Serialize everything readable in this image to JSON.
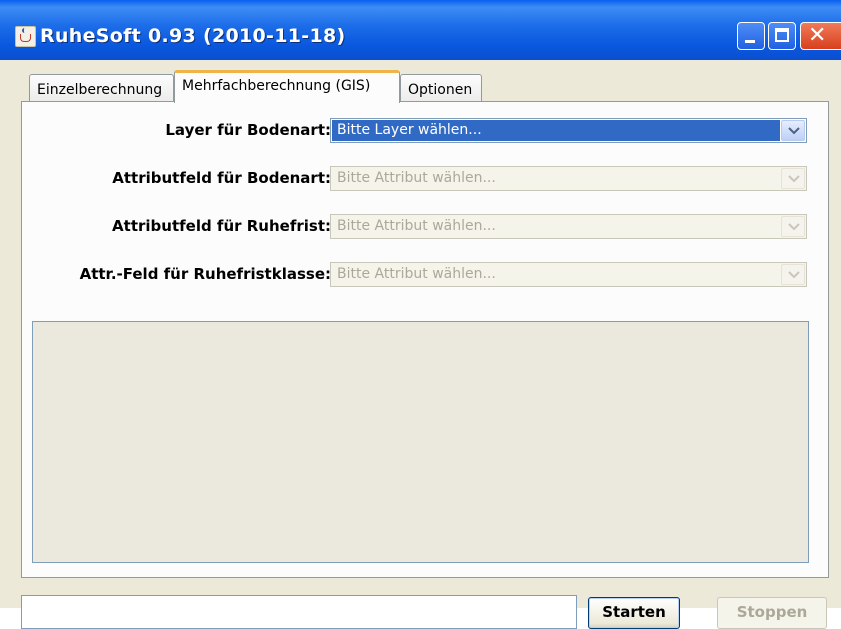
{
  "window": {
    "title": "RuheSoft 0.93 (2010-11-18)",
    "controls": {
      "minimize": "minimize",
      "maximize": "maximize",
      "close": "✕"
    }
  },
  "tabs": [
    {
      "label": "Einzelberechnung",
      "active": false
    },
    {
      "label": "Mehrfachberechnung (GIS)",
      "active": true
    },
    {
      "label": "Optionen",
      "active": false
    }
  ],
  "form": {
    "rows": [
      {
        "label": "Layer für Bodenart:",
        "value": "Bitte Layer wählen...",
        "enabled": true,
        "selected": true
      },
      {
        "label": "Attributfeld für Bodenart:",
        "value": "Bitte Attribut wählen...",
        "enabled": false
      },
      {
        "label": "Attributfeld für Ruhefrist:",
        "value": "Bitte Attribut wählen...",
        "enabled": false
      },
      {
        "label": "Attr.-Feld für Ruhefristklasse:",
        "value": "Bitte Attribut wählen...",
        "enabled": false
      }
    ]
  },
  "output": {
    "text": ""
  },
  "bottom": {
    "status_value": "",
    "start_label": "Starten",
    "stop_label": "Stoppen",
    "stop_enabled": false
  },
  "colors": {
    "titlebar": "#0a58df",
    "selection": "#316ac5",
    "tab_highlight": "#f0b347",
    "window_bg": "#ece9d8",
    "close_button": "#d8401c"
  },
  "icons": {
    "app": "java-coffee-cup-icon",
    "dropdown": "chevron-down-icon"
  }
}
